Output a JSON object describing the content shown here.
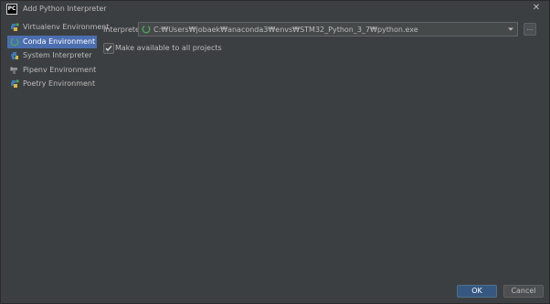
{
  "window": {
    "title": "Add Python Interpreter",
    "app_icon_text": "PC",
    "app_icon_name": "pycharm-icon",
    "close_icon": "close-icon"
  },
  "sidebar": {
    "items": [
      {
        "label": "Virtualenv Environment",
        "icon": "virtualenv-icon",
        "selected": false
      },
      {
        "label": "Conda Environment",
        "icon": "conda-icon",
        "selected": true
      },
      {
        "label": "System Interpreter",
        "icon": "python-icon",
        "selected": false
      },
      {
        "label": "Pipenv Environment",
        "icon": "pipenv-icon",
        "selected": false
      },
      {
        "label": "Poetry Environment",
        "icon": "poetry-icon",
        "selected": false
      }
    ]
  },
  "interpreter": {
    "label": "Interpreter:",
    "value": "C:₩Users₩jobaek₩anaconda3₩envs₩STM32_Python_3_7₩python.exe",
    "browse_label": "..."
  },
  "make_available": {
    "label": "Make available to all projects",
    "checked": true
  },
  "buttons": {
    "ok": "OK",
    "cancel": "Cancel"
  },
  "colors": {
    "background": "#3c3f41",
    "selection": "#4b6eaf",
    "ok_button": "#365880",
    "text": "#bbbbbb",
    "conda_green": "#4aa65a"
  }
}
